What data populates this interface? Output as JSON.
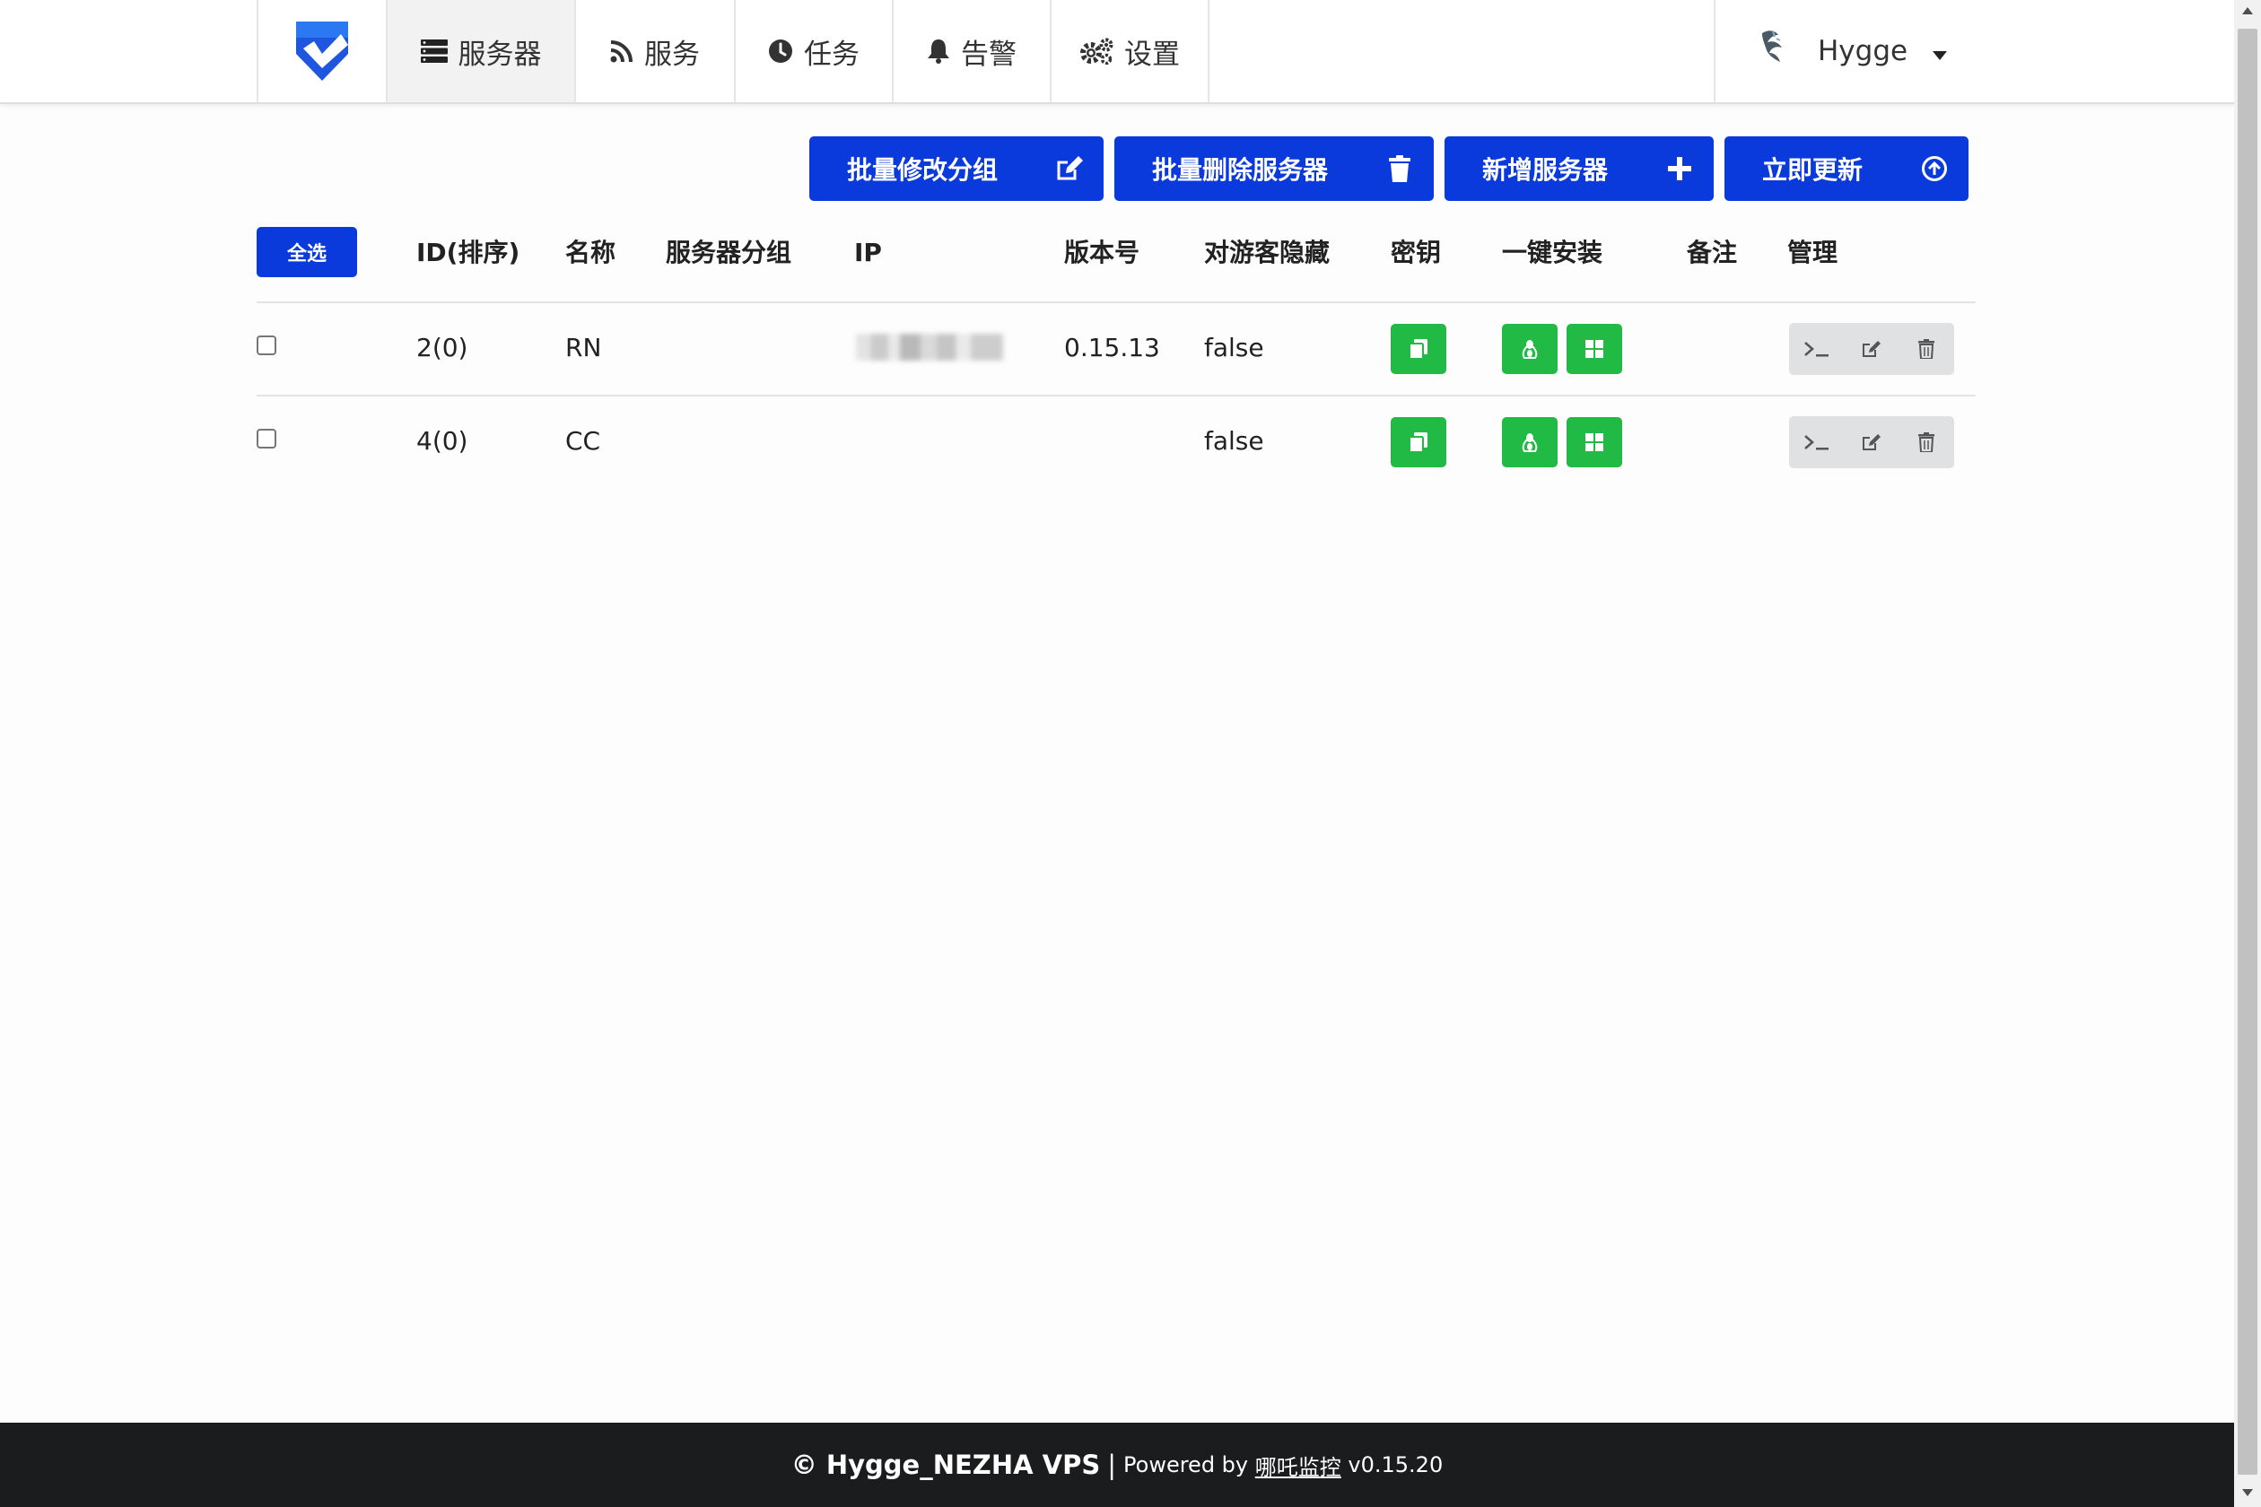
{
  "nav": {
    "items": [
      {
        "label": "服务器",
        "icon": "server-icon",
        "active": true
      },
      {
        "label": "服务",
        "icon": "rss-icon"
      },
      {
        "label": "任务",
        "icon": "clock-icon"
      },
      {
        "label": "告警",
        "icon": "bell-icon"
      },
      {
        "label": "设置",
        "icon": "gears-icon"
      }
    ],
    "user": {
      "name": "Hygge",
      "icon": "avatar"
    }
  },
  "actions": {
    "batch_group": "批量修改分组",
    "batch_delete": "批量删除服务器",
    "add_server": "新增服务器",
    "update_now": "立即更新"
  },
  "table": {
    "select_all": "全选",
    "headers": [
      "ID(排序)",
      "名称",
      "服务器分组",
      "IP",
      "版本号",
      "对游客隐藏",
      "密钥",
      "一键安装",
      "备注",
      "管理"
    ],
    "rows": [
      {
        "id": "2(0)",
        "name": "RN",
        "group": "",
        "ip": "(blurred)",
        "version": "0.15.13",
        "hidden": "false",
        "note": ""
      },
      {
        "id": "4(0)",
        "name": "CC",
        "group": "",
        "ip": "",
        "version": "",
        "hidden": "false",
        "note": ""
      }
    ]
  },
  "footer": {
    "brand": "© Hygge_NEZHA VPS",
    "separator": "|",
    "powered_by": "Powered by",
    "product": "哪吒监控",
    "version": "v0.15.20"
  },
  "colors": {
    "primary": "#0a39dc",
    "green": "#21ba45",
    "footer_bg": "#1b1c1d",
    "mgmt_bg": "#e0e1e2"
  }
}
